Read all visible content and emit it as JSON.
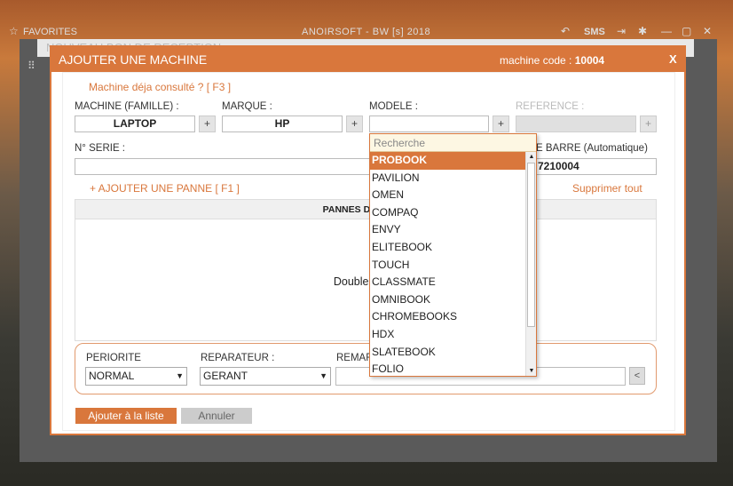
{
  "topbar": {
    "favorites": "FAVORITES",
    "app_title": "ANOIRSOFT - BW [s] 2018",
    "sms": "SMS"
  },
  "behind": {
    "title": "NOUVEAU BON DE RECEPTION"
  },
  "modal": {
    "title": "AJOUTER UNE MACHINE",
    "code_label": "machine code :",
    "code_value": "10004",
    "close": "X",
    "consulted_link": "Machine déja consulté ? [ F3 ]",
    "fields": {
      "famille_label": "MACHINE (FAMILLE) :",
      "famille_value": "LAPTOP",
      "marque_label": "MARQUE :",
      "marque_value": "HP",
      "modele_label": "MODELE :",
      "modele_value": "",
      "reference_label": "REFERENCE :",
      "reference_value": "",
      "serie_label": "N° SERIE :",
      "serie_value": "",
      "barcode_label": "E BARRE (Automatique)",
      "barcode_value": "7210004",
      "plus": "+"
    },
    "add_panne": "+ AJOUTER UNE PANNE [ F1 ]",
    "delete_all": "Supprimer tout",
    "panel_header": "PANNES DECLARE",
    "panel_hint": "Double-clic p",
    "priority_label": "PERIORITE",
    "priority_value": "NORMAL",
    "repairer_label": "REPARATEUR :",
    "repairer_value": "GERANT",
    "remark_label": "REMAR",
    "lt_button": "<",
    "add_button": "Ajouter à la liste",
    "cancel_button": "Annuler"
  },
  "dropdown": {
    "search_placeholder": "Recherche",
    "items": [
      "PROBOOK",
      "PAVILION",
      "OMEN",
      "COMPAQ",
      "ENVY",
      "ELITEBOOK",
      "TOUCH",
      "CLASSMATE",
      "OMNIBOOK",
      "CHROMEBOOKS",
      "HDX",
      "SLATEBOOK",
      "FOLIO"
    ],
    "selected_index": 0
  },
  "colors": {
    "accent": "#d9773c"
  }
}
